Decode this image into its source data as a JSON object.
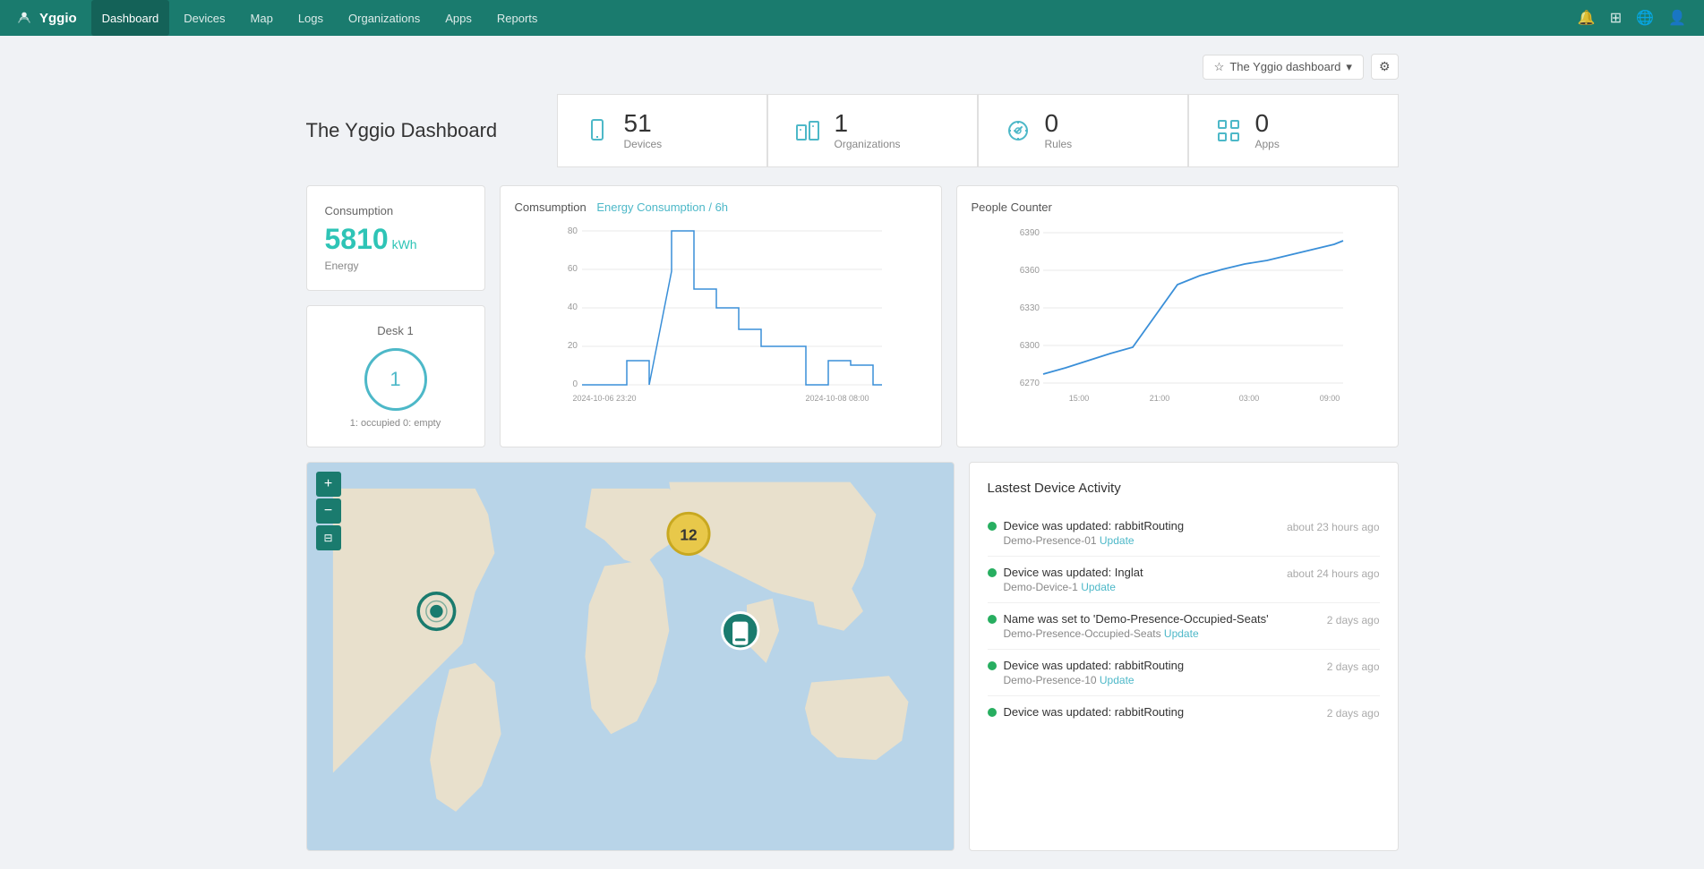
{
  "brand": {
    "name": "Yggio"
  },
  "nav": {
    "items": [
      {
        "label": "Dashboard",
        "active": true
      },
      {
        "label": "Devices",
        "active": false
      },
      {
        "label": "Map",
        "active": false
      },
      {
        "label": "Logs",
        "active": false
      },
      {
        "label": "Organizations",
        "active": false
      },
      {
        "label": "Apps",
        "active": false
      },
      {
        "label": "Reports",
        "active": false
      }
    ]
  },
  "toolbar": {
    "dashboard_selector_label": "The Yggio dashboard",
    "settings_icon": "⚙"
  },
  "dashboard": {
    "title": "The Yggio Dashboard",
    "stats": [
      {
        "icon": "📱",
        "value": "51",
        "label": "Devices"
      },
      {
        "icon": "🏢",
        "value": "1",
        "label": "Organizations"
      },
      {
        "icon": "⚙",
        "value": "0",
        "label": "Rules"
      },
      {
        "icon": "⊞",
        "value": "0",
        "label": "Apps"
      }
    ]
  },
  "consumption": {
    "title": "Consumption",
    "value": "5810",
    "unit": "kWh",
    "label": "Energy"
  },
  "desk": {
    "title": "Desk 1",
    "value": "1",
    "status": "1: occupied 0: empty"
  },
  "energy_chart": {
    "title": "Comsumption",
    "subtitle": "Energy Consumption / 6h",
    "x_labels": [
      "2024-10-06 23:20",
      "2024-10-08 08:00"
    ],
    "y_max": 80,
    "y_labels": [
      "80",
      "60",
      "40",
      "20",
      "0"
    ]
  },
  "people_chart": {
    "title": "People Counter",
    "y_labels": [
      "6390",
      "6360",
      "6330",
      "6300",
      "6270"
    ],
    "x_labels": [
      "15:00",
      "21:00",
      "03:00",
      "09:00"
    ]
  },
  "activity": {
    "title": "Lastest Device Activity",
    "items": [
      {
        "event": "Device was updated: rabbitRouting",
        "sub_device": "Demo-Presence-01",
        "sub_action": "Update",
        "time": "about 23 hours ago"
      },
      {
        "event": "Device was updated: Inglat",
        "sub_device": "Demo-Device-1",
        "sub_action": "Update",
        "time": "about 24 hours ago"
      },
      {
        "event": "Name was set to 'Demo-Presence-Occupied-Seats'",
        "sub_device": "Demo-Presence-Occupied-Seats",
        "sub_action": "Update",
        "time": "2 days ago"
      },
      {
        "event": "Device was updated: rabbitRouting",
        "sub_device": "Demo-Presence-10",
        "sub_action": "Update",
        "time": "2 days ago"
      },
      {
        "event": "Device was updated: rabbitRouting",
        "sub_device": "",
        "sub_action": "",
        "time": "2 days ago"
      }
    ]
  },
  "map": {
    "zoom_in": "+",
    "zoom_out": "−",
    "layer_icon": "⊟"
  }
}
